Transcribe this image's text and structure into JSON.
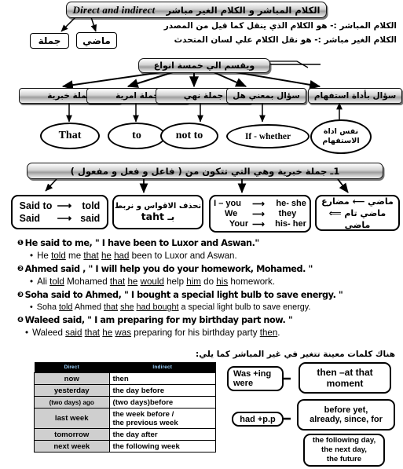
{
  "title": {
    "latin": "Direct and indirect",
    "arabic": "الكلام المباشر و الكلام الغير مباشر"
  },
  "definitions": [
    "الكلام المباشر :- هو الكلام الذي ينقل كما قيل من المصدر",
    "الكلام الغير مباشر :- هو نقل الكلام علي لسان المتحدث"
  ],
  "side_boxes": {
    "sentence": "جملة",
    "past": "ماضي"
  },
  "divider_banner": "ويقسم الي خمسة انواع",
  "categories": [
    {
      "label": "جملة خبرية",
      "keyword": "That"
    },
    {
      "label": "جملة امرية",
      "keyword": "to"
    },
    {
      "label": "جملة نهي",
      "keyword": "not to"
    },
    {
      "label": "سؤال بمعني هل",
      "keyword": "If - whether"
    },
    {
      "label": "سؤال بأداة استفهام",
      "keyword": "نفس اداة الاستفهام"
    }
  ],
  "section1_banner": "1ـ جملة خبرية      وهي التي تتكون من ( فاعل و فعل و مفعول )",
  "rule_boxes": [
    {
      "name": "said-to-told-box",
      "lines": [
        {
          "left": "Said to",
          "arrow": "⟶",
          "right": "told"
        },
        {
          "left": "Said",
          "arrow": "⟶",
          "right": "said"
        }
      ]
    },
    {
      "name": "that-box",
      "arabic": "نحذف الاقواس و نربط",
      "latin": "بـ that"
    },
    {
      "name": "pronoun-box",
      "lines": [
        {
          "left": "I – you",
          "arrow": "⟶",
          "right": "he- she"
        },
        {
          "left": "We",
          "arrow": "⟶",
          "right": "they"
        },
        {
          "left": "Your",
          "arrow": "⟶",
          "right": "his- her"
        }
      ]
    },
    {
      "name": "tense-box",
      "lines": [
        "ماضي  ⟵  مضارع",
        "ماضي تام ⟸ ماضي"
      ]
    }
  ],
  "examples": [
    {
      "num": "❶",
      "direct": "He said to me, \" I have been to Luxor and Aswan.\"",
      "indirect_parts": [
        {
          "t": "He ",
          "u": false
        },
        {
          "t": "told",
          "u": true
        },
        {
          "t": " me ",
          "u": false
        },
        {
          "t": "that",
          "u": true
        },
        {
          "t": " ",
          "u": false
        },
        {
          "t": "he",
          "u": true
        },
        {
          "t": " ",
          "u": false
        },
        {
          "t": "had",
          "u": true
        },
        {
          "t": " been to Luxor and Aswan.",
          "u": false
        }
      ]
    },
    {
      "num": "❷",
      "direct": "Ahmed said , \" I will help you do your homework, Mohamed. \"",
      "indirect_parts": [
        {
          "t": "Ali ",
          "u": false
        },
        {
          "t": "told",
          "u": true
        },
        {
          "t": " Mohamed ",
          "u": false
        },
        {
          "t": "that",
          "u": true
        },
        {
          "t": " ",
          "u": false
        },
        {
          "t": "he",
          "u": true
        },
        {
          "t": " ",
          "u": false
        },
        {
          "t": "would",
          "u": true
        },
        {
          "t": " help ",
          "u": false
        },
        {
          "t": "him",
          "u": true
        },
        {
          "t": " do ",
          "u": false
        },
        {
          "t": "his",
          "u": true
        },
        {
          "t": " homework.",
          "u": false
        }
      ]
    },
    {
      "num": "❸",
      "direct": "Soha said to Ahmed, \" I bought a special light bulb to save energy. \"",
      "indirect_parts": [
        {
          "t": "Soha ",
          "u": false
        },
        {
          "t": "told",
          "u": true
        },
        {
          "t": " Ahmed ",
          "u": false
        },
        {
          "t": "that",
          "u": true
        },
        {
          "t": " ",
          "u": false
        },
        {
          "t": "she",
          "u": true
        },
        {
          "t": " ",
          "u": false
        },
        {
          "t": "had bought",
          "u": true
        },
        {
          "t": " a special light bulb to save energy.",
          "u": false
        }
      ]
    },
    {
      "num": "❹",
      "direct": "Waleed said, \" I am preparing for my birthday part now. \"",
      "indirect_parts": [
        {
          "t": "Waleed ",
          "u": false
        },
        {
          "t": "said",
          "u": true
        },
        {
          "t": " ",
          "u": false
        },
        {
          "t": "that",
          "u": true
        },
        {
          "t": " ",
          "u": false
        },
        {
          "t": "he",
          "u": true
        },
        {
          "t": " ",
          "u": false
        },
        {
          "t": "was",
          "u": true
        },
        {
          "t": " preparing for his birthday party ",
          "u": false
        },
        {
          "t": "then",
          "u": true
        },
        {
          "t": ".",
          "u": false
        }
      ]
    }
  ],
  "table_note": "هناك كلمات معينة تتغير في غير المباشر كما يلي:",
  "table": {
    "headers": [
      "Direct",
      "Indirect"
    ],
    "rows": [
      {
        "direct": "now",
        "indirect": "then"
      },
      {
        "direct": "yesterday",
        "indirect": "the day before"
      },
      {
        "direct": "(two days) ago",
        "indirect": "(two days)before",
        "small": true
      },
      {
        "direct": "last week",
        "indirect_l1": "the week before /",
        "indirect_l2": "the previous week",
        "tall": true
      },
      {
        "direct": "tomorrow",
        "indirect": "the day after"
      },
      {
        "direct": "next week",
        "indirect": "the following week"
      }
    ]
  },
  "right_boxes": {
    "was_were": {
      "l1": "Was   +ing",
      "l2": "were"
    },
    "had_pp": "had   +p.p",
    "then_moment": {
      "l1": "then –at that",
      "l2": "moment"
    },
    "before_yet": {
      "l1": "before    yet,",
      "l2": "already, since, for"
    },
    "following": {
      "l1": "the following day,",
      "l2": "the next day,",
      "l3": "the future"
    }
  },
  "colors": {
    "header_text": "#9fd4ff",
    "header_bg": "#000000",
    "direct_cell_bg": "#cfcfcf",
    "plate_border": "#151515"
  }
}
